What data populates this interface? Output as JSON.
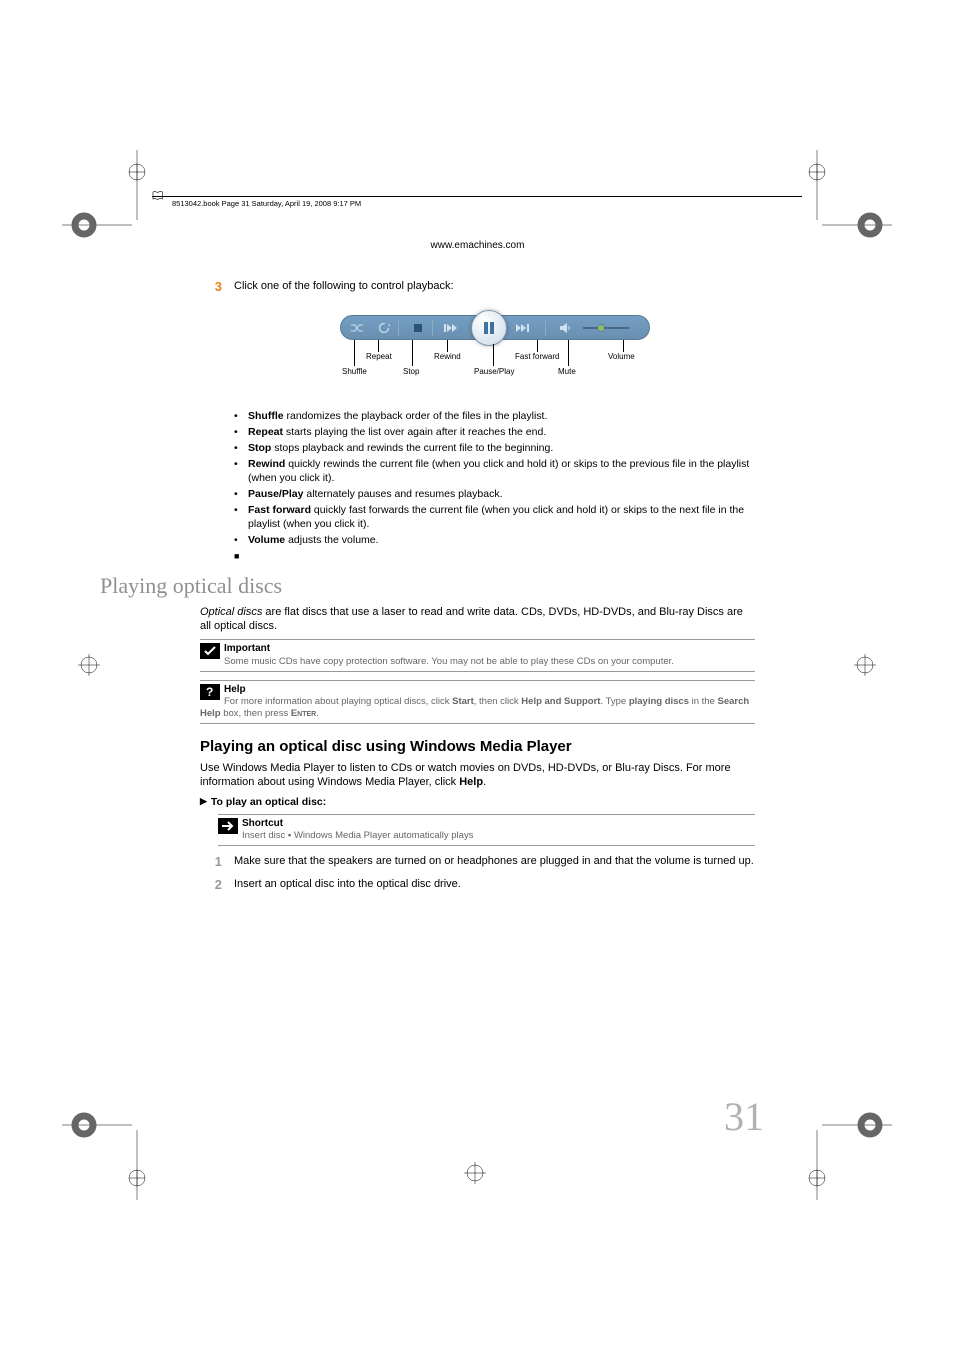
{
  "slug": "8513042.book  Page 31  Saturday, April 19, 2008  9:17 PM",
  "headerUrl": "www.emachines.com",
  "step3": {
    "num": "3",
    "text": "Click one of the following to control playback:"
  },
  "player": {
    "labels": {
      "repeat": "Repeat",
      "rewind": "Rewind",
      "fastforward": "Fast forward",
      "volume": "Volume",
      "shuffle": "Shuffle",
      "stop": "Stop",
      "pauseplay": "Pause/Play",
      "mute": "Mute"
    }
  },
  "bullets": [
    {
      "bold": "Shuffle",
      "rest": " randomizes the playback order of the files in the playlist."
    },
    {
      "bold": "Repeat",
      "rest": " starts playing the list over again after it reaches the end."
    },
    {
      "bold": "Stop",
      "rest": " stops playback and rewinds the current file to the beginning."
    },
    {
      "bold": "Rewind",
      "rest": " quickly rewinds the current file (when you click and hold it) or skips to the previous file in the playlist (when you click it)."
    },
    {
      "bold": "Pause/Play",
      "rest": " alternately pauses and resumes playback."
    },
    {
      "bold": "Fast forward",
      "rest": " quickly fast forwards the current file (when you click and hold it) or skips to the next file in the playlist (when you click it)."
    },
    {
      "bold": "Volume",
      "rest": " adjusts the volume."
    }
  ],
  "sectionTitle": "Playing optical discs",
  "introPara": {
    "italic": "Optical discs",
    "rest": " are flat discs that use a laser to read and write data. CDs, DVDs, HD-DVDs, and Blu-ray Discs are all optical discs."
  },
  "importantBox": {
    "title": "Important",
    "body": "Some music CDs have copy protection software. You may not be able to play these CDs on your computer."
  },
  "helpBox": {
    "title": "Help",
    "body_pre": "For more information about playing optical discs, click ",
    "body_start": "Start",
    "body_mid": ", then click ",
    "body_has": "Help and Support",
    "body_type": ". Type ",
    "body_kw": "playing discs",
    "body_in": " in the ",
    "body_sh": "Search Help",
    "body_box": " box, then press ",
    "body_enter": "Enter",
    "body_end": "."
  },
  "subsectionTitle": "Playing an optical disc using Windows Media Player",
  "subsectionPara": {
    "text": "Use Windows Media Player to listen to CDs or watch movies on DVDs, HD-DVDs, or Blu-ray Discs. For more information about using Windows Media Player, click ",
    "help": "Help",
    "end": "."
  },
  "procTitle": "To play an optical disc:",
  "shortcutBox": {
    "title": "Shortcut",
    "body": "Insert disc ▪ Windows Media Player automatically plays"
  },
  "steps": [
    {
      "num": "1",
      "text": "Make sure that the speakers are turned on or headphones are plugged in and that the volume is turned up."
    },
    {
      "num": "2",
      "text": "Insert an optical disc into the optical disc drive."
    }
  ],
  "pageNumber": "31"
}
